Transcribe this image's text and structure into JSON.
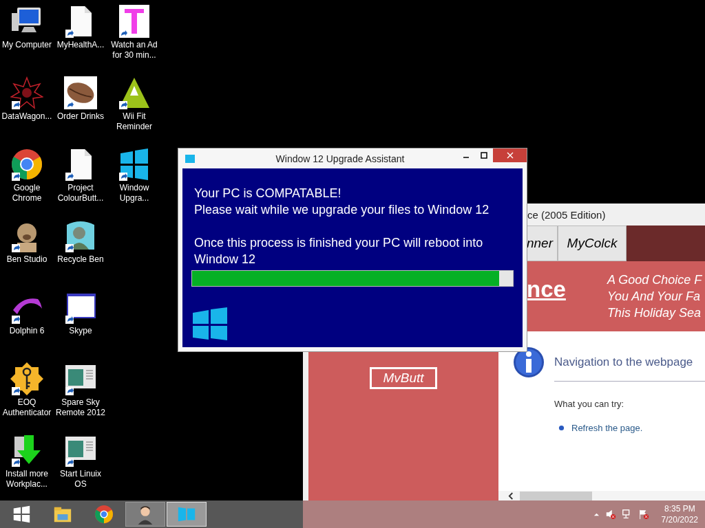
{
  "desktop_icons": [
    {
      "label": "My Computer",
      "kind": "computer",
      "shortcut": false
    },
    {
      "label": "DataWagon...",
      "kind": "starburst",
      "shortcut": true
    },
    {
      "label": "Google\nChrome",
      "kind": "chrome",
      "shortcut": true
    },
    {
      "label": "Ben Studio",
      "kind": "dog",
      "shortcut": true
    },
    {
      "label": "Dolphin 6",
      "kind": "dolphin",
      "shortcut": true
    },
    {
      "label": "EOQ\nAuthenticator",
      "kind": "key",
      "shortcut": true
    },
    {
      "label": "Install more\nWorkplac...",
      "kind": "download",
      "shortcut": true
    },
    {
      "label": "MyHealthA...",
      "kind": "document",
      "shortcut": true
    },
    {
      "label": "Order Drinks",
      "kind": "bean",
      "shortcut": true
    },
    {
      "label": "Project\nColourButt...",
      "kind": "document",
      "shortcut": true
    },
    {
      "label": "Recycle Ben",
      "kind": "person",
      "shortcut": true
    },
    {
      "label": "Skype",
      "kind": "window",
      "shortcut": true
    },
    {
      "label": "Spare Sky\nRemote 2012",
      "kind": "app",
      "shortcut": true
    },
    {
      "label": "Start Linuix\nOS",
      "kind": "app",
      "shortcut": true
    },
    {
      "label": "Watch an Ad\nfor 30 min...",
      "kind": "letter",
      "shortcut": true
    },
    {
      "label": "Wii Fit\nReminder",
      "kind": "triangle",
      "shortcut": true
    },
    {
      "label": "Window\nUpgra...",
      "kind": "windows",
      "shortcut": true
    }
  ],
  "browser_window": {
    "title": "ce (2005 Edition)",
    "tabs": [
      "nner",
      "MyColck"
    ],
    "banner_link": "nce",
    "tagline": "A Good Choice F\nYou And Your Fa\nThis Holiday Sea",
    "side_button": "MvButt",
    "error_page": {
      "heading": "Navigation to the webpage",
      "subheading": "What you can try:",
      "suggestions": [
        "Refresh the page."
      ]
    }
  },
  "dialog": {
    "title": "Window 12 Upgrade Assistant",
    "messages": [
      "Your PC is COMPATABLE!\nPlease wait while we upgrade your files to Window 12",
      "Once this process is finished your PC will reboot into Window 12"
    ],
    "progress": {
      "level": 0.957
    }
  },
  "taskbar": {
    "items": [
      {
        "kind": "start",
        "open": false
      },
      {
        "kind": "explorer",
        "open": false
      },
      {
        "kind": "chrome",
        "open": false
      },
      {
        "kind": "person",
        "open": true
      },
      {
        "kind": "windows",
        "open": true
      }
    ],
    "time": "8:35 PM",
    "date": "7/20/2022"
  }
}
